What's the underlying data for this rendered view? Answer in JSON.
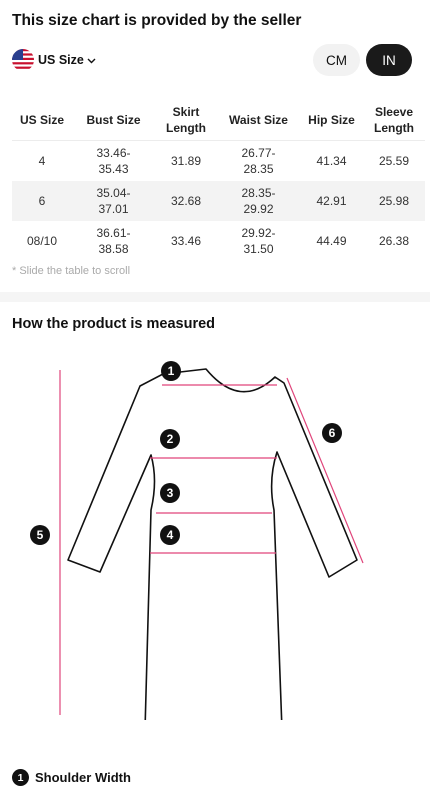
{
  "header": {
    "title": "This size chart is provided by the seller"
  },
  "size_system": {
    "label": "US Size",
    "flag_icon": "us-flag-icon"
  },
  "unit_toggle": {
    "cm_label": "CM",
    "in_label": "IN",
    "selected": "IN"
  },
  "colors": {
    "accent": "#e0457b",
    "dark": "#1a1a1a"
  },
  "table": {
    "headers": [
      "US Size",
      "Bust Size",
      "Skirt Length",
      "Waist Size",
      "Hip Size",
      "Sleeve Length"
    ],
    "rows": [
      [
        "4",
        "33.46-35.43",
        "31.89",
        "26.77-28.35",
        "41.34",
        "25.59"
      ],
      [
        "6",
        "35.04-37.01",
        "32.68",
        "28.35-29.92",
        "42.91",
        "25.98"
      ],
      [
        "08/10",
        "36.61-38.58",
        "33.46",
        "29.92-31.50",
        "44.49",
        "26.38"
      ]
    ]
  },
  "hint": "* Slide the table to scroll",
  "section": {
    "title": "How the product is measured"
  },
  "diagram": {
    "markers": [
      "1",
      "2",
      "3",
      "4",
      "5",
      "6"
    ]
  },
  "measure": {
    "number": "1",
    "label": "Shoulder Width"
  }
}
